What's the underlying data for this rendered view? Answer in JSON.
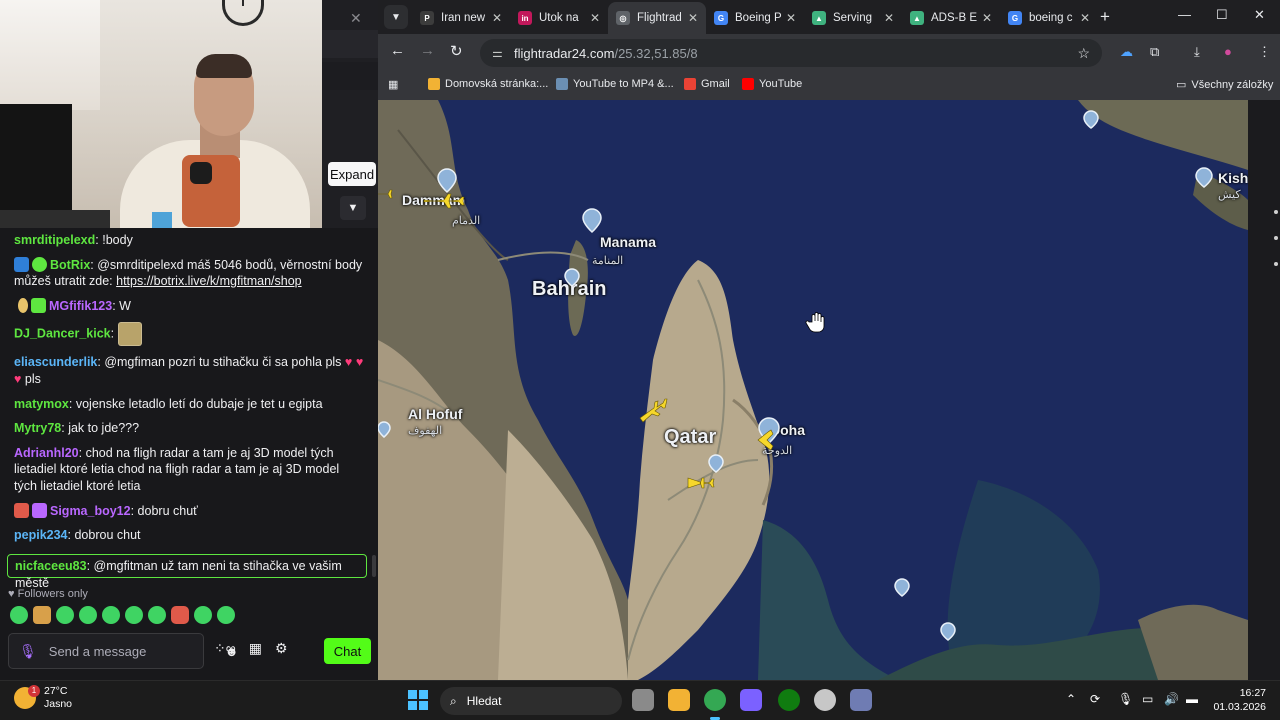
{
  "stream": {
    "expand_tooltip": "Expand",
    "messages": [
      {
        "user": "smrditipelexd",
        "color": "#5ee640",
        "text": "!body",
        "badges": []
      },
      {
        "user": "BotRix",
        "color": "#5ee640",
        "text": "@smrditipelexd máš 5046 bodů, věrnostní body můžeš utratit zde: ",
        "link": "https://botrix.live/k/mgfitman/shop",
        "badges": [
          "bot",
          "verified"
        ]
      },
      {
        "user": "MGfifik123",
        "color": "#b967ff",
        "text": "W",
        "badges": [
          "bulb",
          "gift"
        ]
      },
      {
        "user": "DJ_Dancer_kick",
        "color": "#5ee640",
        "text": "",
        "emote": "dancer-emote",
        "badges": []
      },
      {
        "user": "eliascunderlik",
        "color": "#5bb5f7",
        "text": "@mgfiman pozri tu stihačku či sa pohla pls ",
        "text_after": " pls",
        "badges": []
      },
      {
        "user": "matymox",
        "color": "#5ee640",
        "text": "vojenske letadlo letí do dubaje je tet u egipta",
        "badges": []
      },
      {
        "user": "Mytry78",
        "color": "#5ee640",
        "text": "jak to jde???",
        "badges": []
      },
      {
        "user": "Adrianhl20",
        "color": "#b967ff",
        "text": "chod na fligh radar a tam je aj 3D model tých lietadiel ktoré letia chod na fligh radar a tam je aj 3D model tých lietadiel ktoré letia",
        "badges": []
      },
      {
        "user": "Sigma_boy12",
        "color": "#b967ff",
        "text": "dobru chuť",
        "badges": [
          "gamepad",
          "gift"
        ]
      },
      {
        "user": "pepik234",
        "color": "#5bb5f7",
        "text": "dobrou chut",
        "badges": []
      }
    ],
    "highlighted": {
      "user": "nicfaceeu83",
      "color": "#5ee640",
      "text": "@mgfitman už tam neni ta stihačka ve vašim městě"
    },
    "followers_label": "Followers only",
    "input_placeholder": "Send a message",
    "chat_button": "Chat"
  },
  "browser": {
    "tabs": [
      {
        "label": "Iran new",
        "favicon_color": "#3c3c3c",
        "favicon_text": "P",
        "active": false
      },
      {
        "label": "Útok na",
        "favicon_color": "#c2185b",
        "favicon_text": "in",
        "active": false
      },
      {
        "label": "Flightrad",
        "favicon_color": "#5f6368",
        "favicon_text": "◎",
        "active": true
      },
      {
        "label": "Boeing P",
        "favicon_color": "#4285f4",
        "favicon_text": "G",
        "active": false
      },
      {
        "label": "Serving",
        "favicon_color": "#3fb27f",
        "favicon_text": "▲",
        "active": false
      },
      {
        "label": "ADS-B E",
        "favicon_color": "#3fb27f",
        "favicon_text": "▲",
        "active": false
      },
      {
        "label": "boeing c",
        "favicon_color": "#4285f4",
        "favicon_text": "G",
        "active": false
      }
    ],
    "url_domain": "flightradar24.com",
    "url_path": "/25.32,51.85/8",
    "bookmarks": [
      {
        "label": "Domovská stránka:...",
        "color": "#f2b234"
      },
      {
        "label": "YouTube to MP4 &...",
        "color": "#6b8fb3"
      },
      {
        "label": "Gmail",
        "color": "#ea4335"
      },
      {
        "label": "YouTube",
        "color": "#ff0000"
      }
    ],
    "all_bookmarks": "Všechny záložky"
  },
  "map": {
    "places": {
      "dammam": "Dammam",
      "dammam_ar": "الدمام",
      "manama": "Manama",
      "manama_ar": "المنامة",
      "bahrain": "Bahrain",
      "qatar": "Qatar",
      "doha": "Doha",
      "doha_ar": "الدوحة",
      "hofuf": "Al Hofuf",
      "hofuf_ar": "الهفوف",
      "kish": "Kish",
      "kish_ar": "کیش"
    }
  },
  "taskbar": {
    "temperature": "27°C",
    "weather": "Jasno",
    "weather_badge": "1",
    "search": "Hledat",
    "time": "16:27",
    "date": "01.03.2026"
  }
}
